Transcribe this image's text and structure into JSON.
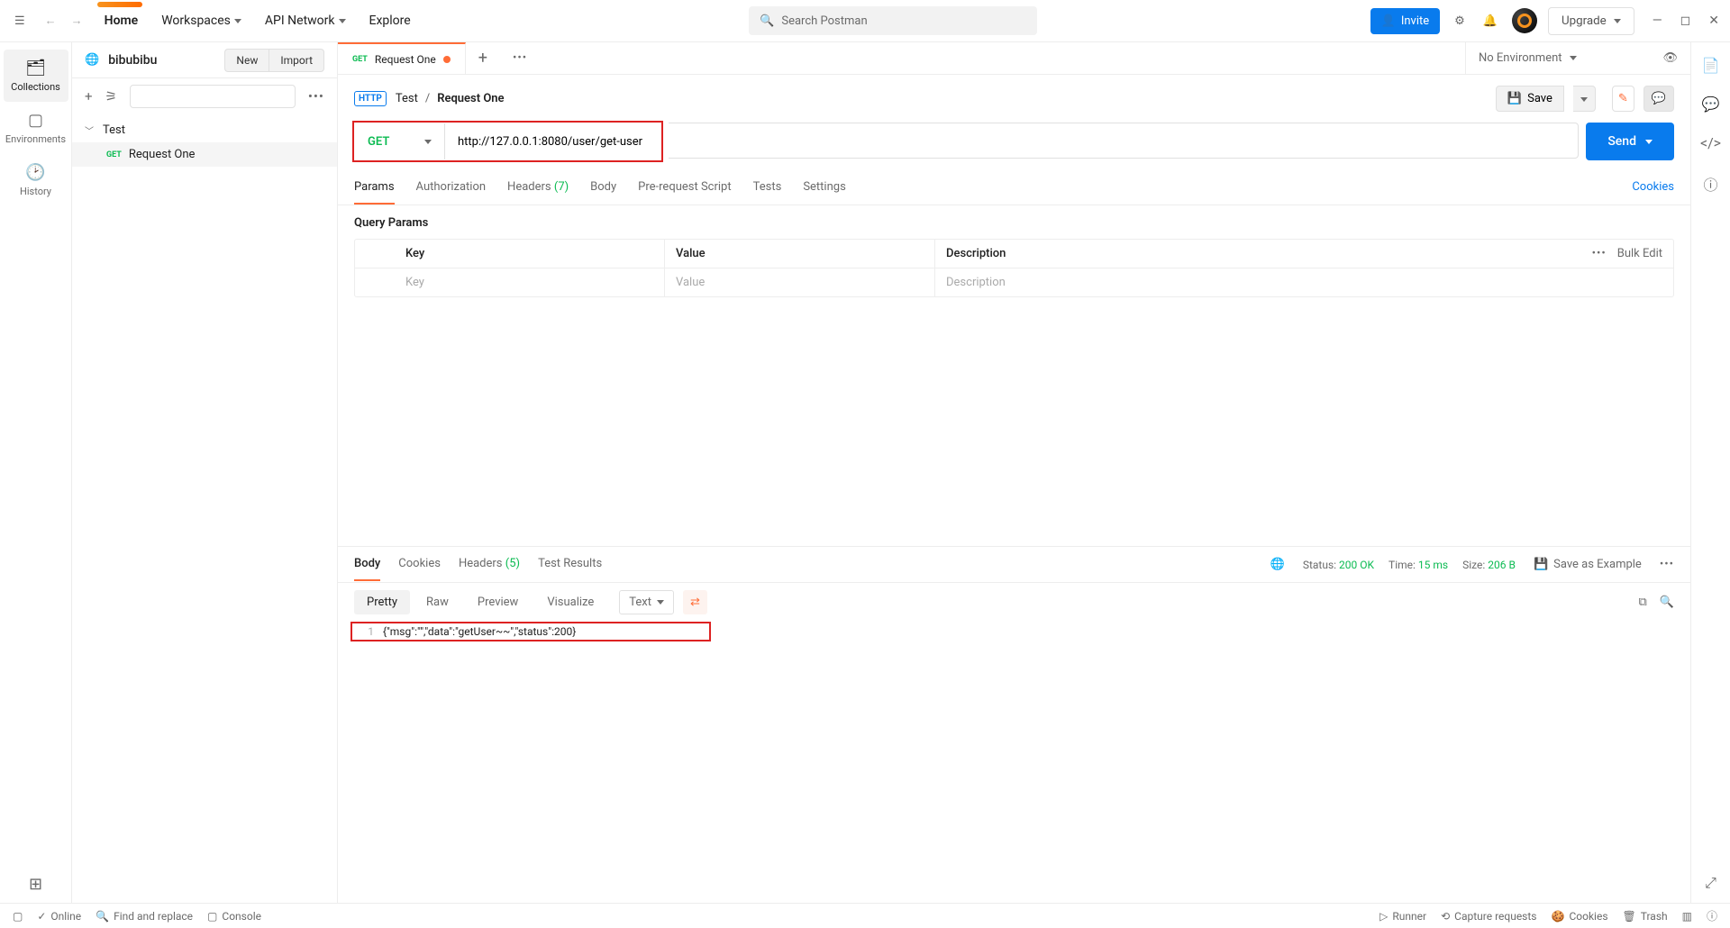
{
  "header": {
    "nav": {
      "home": "Home",
      "workspaces": "Workspaces",
      "api_network": "API Network",
      "explore": "Explore"
    },
    "search_placeholder": "Search Postman",
    "invite": "Invite",
    "upgrade": "Upgrade"
  },
  "left_rail": {
    "collections": "Collections",
    "environments": "Environments",
    "history": "History"
  },
  "sidebar": {
    "workspace": "bibubibu",
    "new_btn": "New",
    "import_btn": "Import",
    "tree": {
      "collection": "Test",
      "request_method": "GET",
      "request_name": "Request One"
    }
  },
  "env": {
    "current": "No Environment"
  },
  "tab": {
    "method": "GET",
    "name": "Request One"
  },
  "breadcrumb": {
    "collection": "Test",
    "sep": "/",
    "request": "Request One"
  },
  "save": "Save",
  "url": {
    "method": "GET",
    "value": "http://127.0.0.1:8080/user/get-user"
  },
  "send": "Send",
  "req_tabs": {
    "params": "Params",
    "authorization": "Authorization",
    "headers": "Headers",
    "headers_count": "(7)",
    "body": "Body",
    "pre_request": "Pre-request Script",
    "tests": "Tests",
    "settings": "Settings",
    "cookies": "Cookies"
  },
  "query": {
    "title": "Query Params",
    "headers": {
      "key": "Key",
      "value": "Value",
      "desc": "Description"
    },
    "placeholders": {
      "key": "Key",
      "value": "Value",
      "desc": "Description"
    },
    "bulk_edit": "Bulk Edit",
    "more": "•••"
  },
  "resp_tabs": {
    "body": "Body",
    "cookies": "Cookies",
    "headers": "Headers",
    "headers_count": "(5)",
    "test_results": "Test Results"
  },
  "resp_status": {
    "status_label": "Status:",
    "status_value": "200 OK",
    "time_label": "Time:",
    "time_value": "15 ms",
    "size_label": "Size:",
    "size_value": "206 B",
    "save_example": "Save as Example"
  },
  "resp_view": {
    "pretty": "Pretty",
    "raw": "Raw",
    "preview": "Preview",
    "visualize": "Visualize",
    "format": "Text"
  },
  "resp_body": {
    "line_no": "1",
    "content": "{\"msg\":\"\",\"data\":\"getUser~~\",\"status\":200}"
  },
  "footer": {
    "online": "Online",
    "find": "Find and replace",
    "console": "Console",
    "runner": "Runner",
    "capture": "Capture requests",
    "cookies": "Cookies",
    "trash": "Trash"
  }
}
